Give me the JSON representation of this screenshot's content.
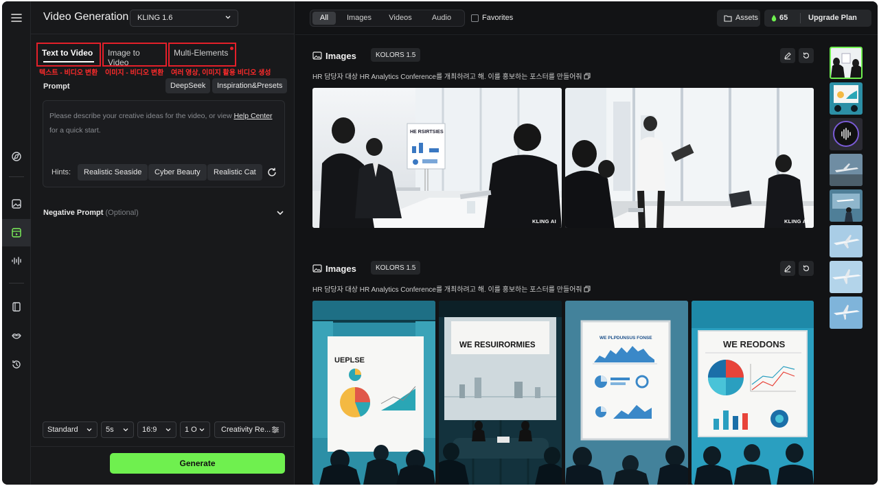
{
  "header": {
    "title": "Video Generation",
    "model": "KLING 1.6"
  },
  "tabs": [
    {
      "label": "Text to Video",
      "annotation": "텍스트 - 비디오 변환"
    },
    {
      "label": "Image to Video",
      "annotation": "이미지 - 비디오 변환"
    },
    {
      "label": "Multi-Elements",
      "annotation": "여러 영상, 이미지 활용 비디오 생성"
    }
  ],
  "prompt": {
    "label": "Prompt",
    "deepseek": "DeepSeek",
    "inspiration": "Inspiration&Presets",
    "placeholder_before": "Please describe your creative ideas for the video, or view ",
    "help_link": "Help Center",
    "placeholder_after": " for a quick start.",
    "hints_label": "Hints:",
    "hints": [
      "Realistic Seaside",
      "Cyber Beauty",
      "Realistic Cat"
    ]
  },
  "negative": {
    "label": "Negative Prompt",
    "optional": "(Optional)"
  },
  "options": {
    "mode": "Standard",
    "duration": "5s",
    "ratio": "16:9",
    "count": "1 O",
    "creativity": "Creativity Re..."
  },
  "generate_label": "Generate",
  "filters": [
    "All",
    "Images",
    "Videos",
    "Audio"
  ],
  "favorites_label": "Favorites",
  "assets_label": "Assets",
  "credits": "65",
  "upgrade_label": "Upgrade Plan",
  "sections": [
    {
      "title": "Images",
      "model": "KOLORS 1.5",
      "desc": "HR 담당자 대상 HR Analytics Conference를 개최하려고 해. 이를 홍보하는 포스터를 만들어줘",
      "images": [
        {
          "board_text": "HE RSIRTSIES",
          "watermark": "KLING AI"
        },
        {
          "board_text": "",
          "watermark": "KLING AI"
        }
      ]
    },
    {
      "title": "Images",
      "model": "KOLORS 1.5",
      "desc": "HR 담당자 대상 HR Analytics Conference를 개최하려고 해. 이를 홍보하는 포스터를 만들어줘",
      "images": [
        {
          "board_text": "UEPLSE"
        },
        {
          "board_text": "WE RESUIRORMIES"
        },
        {
          "board_text": "WE PLPDUNSUS FONSE"
        },
        {
          "board_text": "WE REODONS"
        }
      ]
    }
  ],
  "colors": {
    "accent_green": "#6ff04f",
    "annotation_red": "#e5202a",
    "background": "#121315",
    "panel": "#18191b"
  }
}
